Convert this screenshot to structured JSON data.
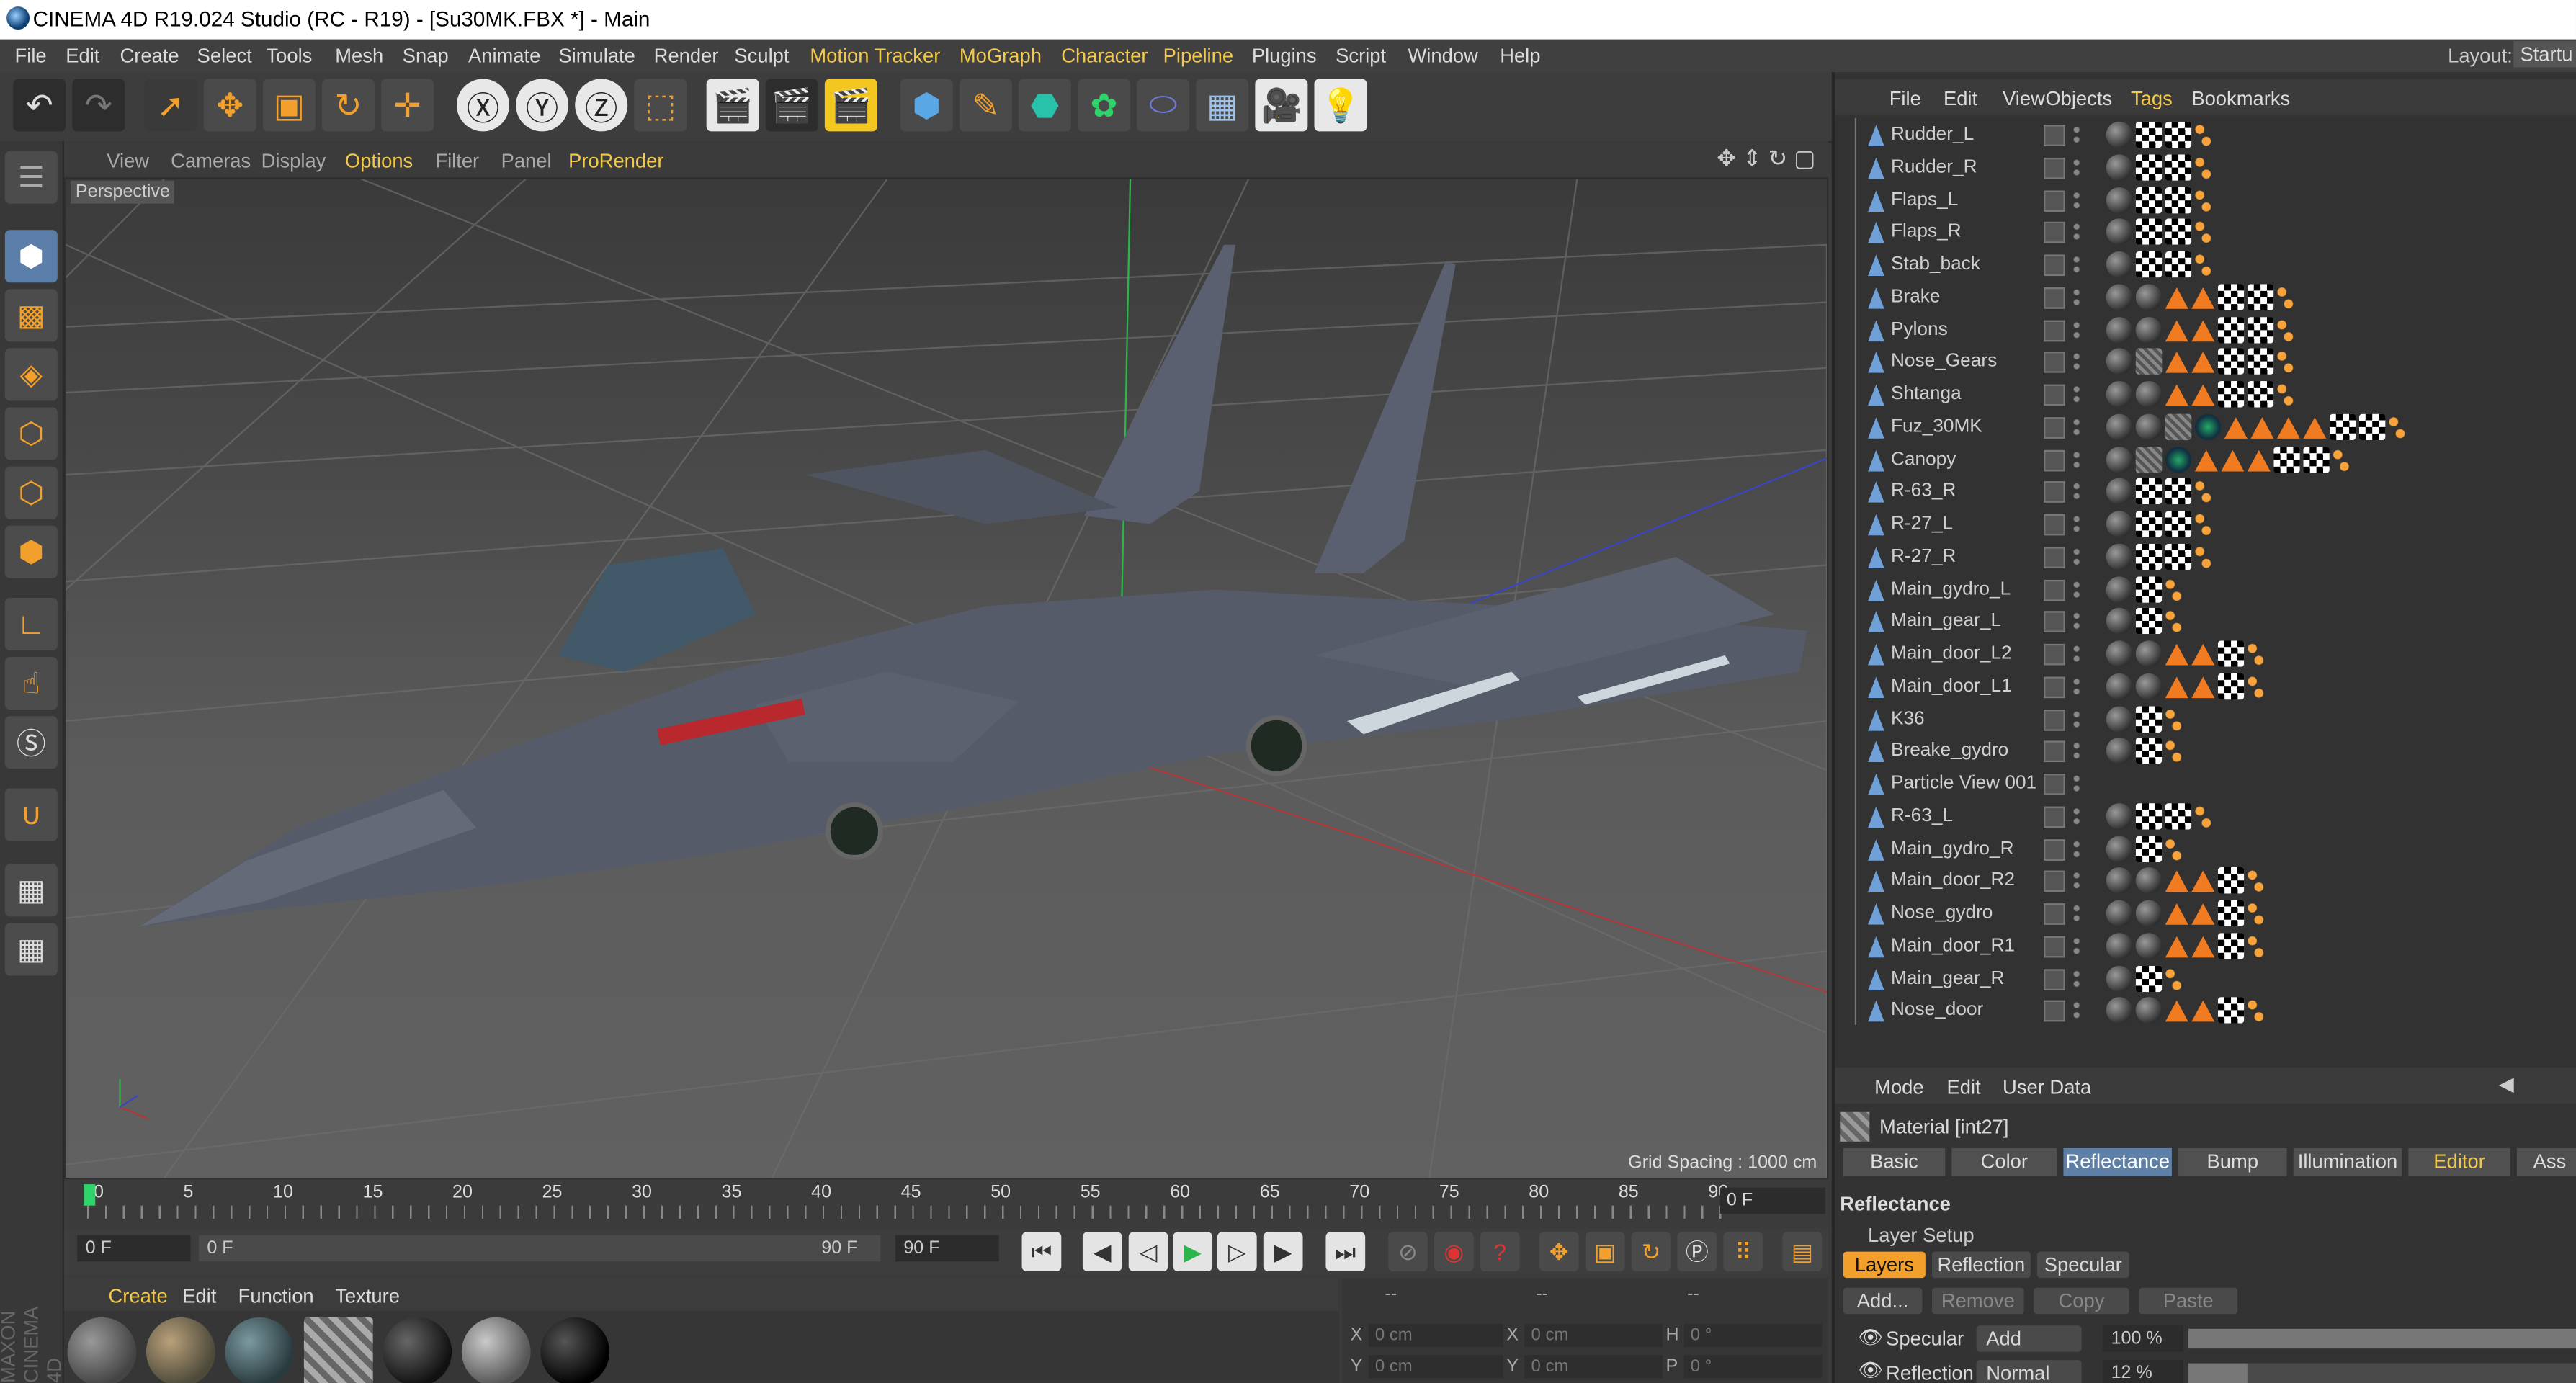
{
  "window": {
    "title": "CINEMA 4D R19.024 Studio (RC - R19) - [Su30MK.FBX *] - Main"
  },
  "menubar": [
    "File",
    "Edit",
    "Create",
    "Select",
    "Tools",
    "Mesh",
    "Snap",
    "Animate",
    "Simulate",
    "Render",
    "Sculpt",
    "Motion Tracker",
    "MoGraph",
    "Character",
    "Pipeline",
    "Plugins",
    "Script",
    "Window",
    "Help"
  ],
  "layout": {
    "label": "Layout:",
    "value": "Startu"
  },
  "viewport": {
    "menu": [
      "View",
      "Cameras",
      "Display",
      "Options",
      "Filter",
      "Panel",
      "ProRender"
    ],
    "label": "Perspective",
    "grid_spacing": "Grid Spacing : 1000 cm"
  },
  "object_manager": {
    "menu": [
      "File",
      "Edit",
      "View",
      "Objects",
      "Tags",
      "Bookmarks"
    ],
    "objects": [
      {
        "name": "Rudder_L",
        "tags": [
          "mat",
          "chk",
          "chk",
          "ph"
        ]
      },
      {
        "name": "Rudder_R",
        "tags": [
          "mat",
          "chk",
          "chk",
          "ph"
        ]
      },
      {
        "name": "Flaps_L",
        "tags": [
          "mat",
          "chk",
          "chk",
          "ph"
        ]
      },
      {
        "name": "Flaps_R",
        "tags": [
          "mat",
          "chk",
          "chk",
          "ph"
        ]
      },
      {
        "name": "Stab_back",
        "tags": [
          "mat",
          "chk",
          "chk",
          "ph"
        ]
      },
      {
        "name": "Brake",
        "tags": [
          "mat",
          "mat",
          "tri",
          "tri",
          "chk",
          "chk",
          "ph"
        ]
      },
      {
        "name": "Pylons",
        "tags": [
          "mat",
          "mat",
          "tri",
          "tri",
          "chk",
          "chk",
          "ph"
        ]
      },
      {
        "name": "Nose_Gears",
        "tags": [
          "mat",
          "tex",
          "tri",
          "tri",
          "chk",
          "chk",
          "ph"
        ]
      },
      {
        "name": "Shtanga",
        "tags": [
          "mat",
          "mat",
          "tri",
          "tri",
          "chk",
          "chk",
          "ph"
        ]
      },
      {
        "name": "Fuz_30MK",
        "tags": [
          "mat",
          "mat",
          "tex",
          "gear",
          "tri",
          "tri",
          "tri",
          "tri",
          "chk",
          "chk",
          "ph"
        ]
      },
      {
        "name": "Canopy",
        "tags": [
          "mat",
          "tex",
          "gear",
          "tri",
          "tri",
          "tri",
          "chk",
          "chk",
          "ph"
        ]
      },
      {
        "name": "R-63_R",
        "tags": [
          "mat",
          "chk",
          "chk",
          "ph"
        ]
      },
      {
        "name": "R-27_L",
        "tags": [
          "mat",
          "chk",
          "chk",
          "ph"
        ]
      },
      {
        "name": "R-27_R",
        "tags": [
          "mat",
          "chk",
          "chk",
          "ph"
        ]
      },
      {
        "name": "Main_gydro_L",
        "tags": [
          "mat",
          "chk",
          "ph"
        ]
      },
      {
        "name": "Main_gear_L",
        "tags": [
          "mat",
          "chk",
          "ph"
        ]
      },
      {
        "name": "Main_door_L2",
        "tags": [
          "mat",
          "mat",
          "tri",
          "tri",
          "chk",
          "ph"
        ]
      },
      {
        "name": "Main_door_L1",
        "tags": [
          "mat",
          "mat",
          "tri",
          "tri",
          "chk",
          "ph"
        ]
      },
      {
        "name": "K36",
        "tags": [
          "mat",
          "chk",
          "ph"
        ]
      },
      {
        "name": "Breake_gydro",
        "tags": [
          "mat",
          "chk",
          "ph"
        ]
      },
      {
        "name": "Particle View 001",
        "tags": []
      },
      {
        "name": "R-63_L",
        "tags": [
          "mat",
          "chk",
          "chk",
          "ph"
        ]
      },
      {
        "name": "Main_gydro_R",
        "tags": [
          "mat",
          "chk",
          "ph"
        ]
      },
      {
        "name": "Main_door_R2",
        "tags": [
          "mat",
          "mat",
          "tri",
          "tri",
          "chk",
          "ph"
        ]
      },
      {
        "name": "Nose_gydro",
        "tags": [
          "mat",
          "mat",
          "tri",
          "tri",
          "chk",
          "ph"
        ]
      },
      {
        "name": "Main_door_R1",
        "tags": [
          "mat",
          "mat",
          "tri",
          "tri",
          "chk",
          "ph"
        ]
      },
      {
        "name": "Main_gear_R",
        "tags": [
          "mat",
          "chk",
          "ph"
        ]
      },
      {
        "name": "Nose_door",
        "tags": [
          "mat",
          "mat",
          "tri",
          "tri",
          "chk",
          "ph"
        ]
      }
    ]
  },
  "attributes": {
    "menu": [
      "Mode",
      "Edit",
      "User Data"
    ],
    "material": "Material [int27]",
    "tabs": [
      "Basic",
      "Color",
      "Reflectance",
      "Bump",
      "Illumination",
      "Editor",
      "Ass"
    ],
    "active_tab": "Reflectance",
    "section": "Reflectance",
    "layer_setup": "Layer Setup",
    "layer_tabs": [
      "Layers",
      "Reflection",
      "Specular"
    ],
    "buttons": [
      "Add...",
      "Remove",
      "Copy",
      "Paste"
    ],
    "specular": {
      "label": "Specular",
      "mode": "Add",
      "value": "100 %"
    },
    "reflection": {
      "label": "Reflection",
      "mode": "Normal",
      "value": "12 %"
    }
  },
  "timeline": {
    "ticks": [
      "0",
      "5",
      "10",
      "15",
      "20",
      "25",
      "30",
      "35",
      "40",
      "45",
      "50",
      "55",
      "60",
      "65",
      "70",
      "75",
      "80",
      "85",
      "90"
    ],
    "current_frame": "0 F",
    "start": "0 F",
    "range_start": "0 F",
    "range_end": "90 F",
    "end": "90 F"
  },
  "material_manager": {
    "menu": [
      "Create",
      "Edit",
      "Function",
      "Texture"
    ]
  },
  "coordinates": {
    "labels": [
      "X",
      "X",
      "H",
      "Y",
      "Y",
      "P"
    ],
    "pos_x": "0 cm",
    "size_x": "0 cm",
    "rot_h": "0 °",
    "pos_y": "0 cm",
    "size_y": "0 cm",
    "rot_p": "0 °",
    "dash": "--"
  },
  "side_label": "MAXON CINEMA 4D",
  "colors": {
    "accent": "#f2c94c",
    "orange": "#f2a02b",
    "active_tab": "#5e7fa6",
    "timeline_marker": "#2fd36a"
  }
}
